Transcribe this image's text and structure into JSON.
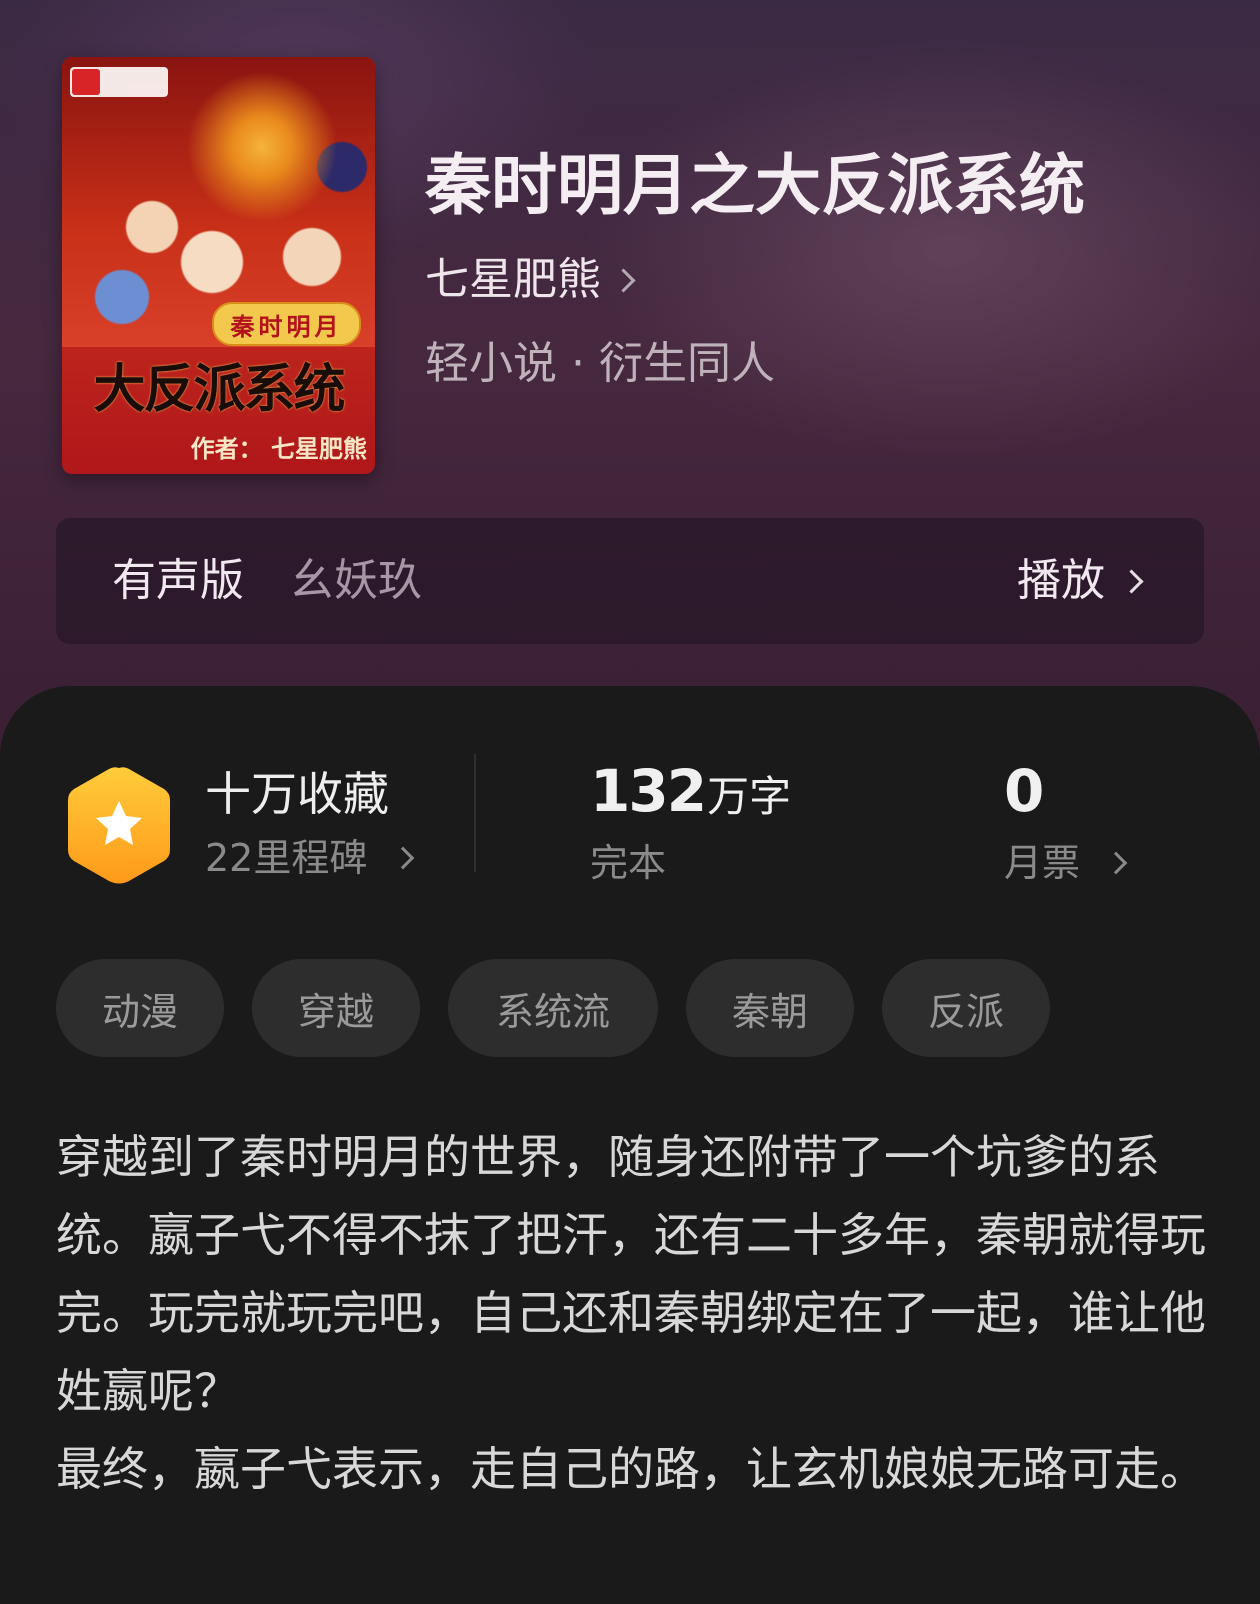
{
  "book": {
    "title": "秦时明月之大反派系统",
    "author": "七星肥熊",
    "genre": "轻小说 · 衍生同人",
    "cover": {
      "subtitle": "秦时明月",
      "title": "大反派系统",
      "author_line": "作者： 七星肥熊"
    }
  },
  "audio": {
    "label": "有声版",
    "narrator": "幺妖玖",
    "play_label": "播放"
  },
  "stats": {
    "collection": {
      "main": "十万收藏",
      "sub": "22里程碑"
    },
    "words": {
      "number": "132",
      "unit": "万字",
      "sub": "完本"
    },
    "monthly_votes": {
      "value": "0",
      "sub": "月票"
    }
  },
  "tags": [
    "动漫",
    "穿越",
    "系统流",
    "秦朝",
    "反派"
  ],
  "description": "穿越到了秦时明月的世界，随身还附带了一个坑爹的系统。嬴子弋不得不抹了把汗，还有二十多年，秦朝就得玩完。玩完就玩完吧，自己还和秦朝绑定在了一起，谁让他姓嬴呢？\n最终，嬴子弋表示，走自己的路，让玄机娘娘无路可走。",
  "colors": {
    "badge_gradient": [
      "#ffcc3a",
      "#ff9a1a"
    ],
    "panel_bg": "#1a1a1a",
    "tag_bg": "#2d2d2d"
  }
}
